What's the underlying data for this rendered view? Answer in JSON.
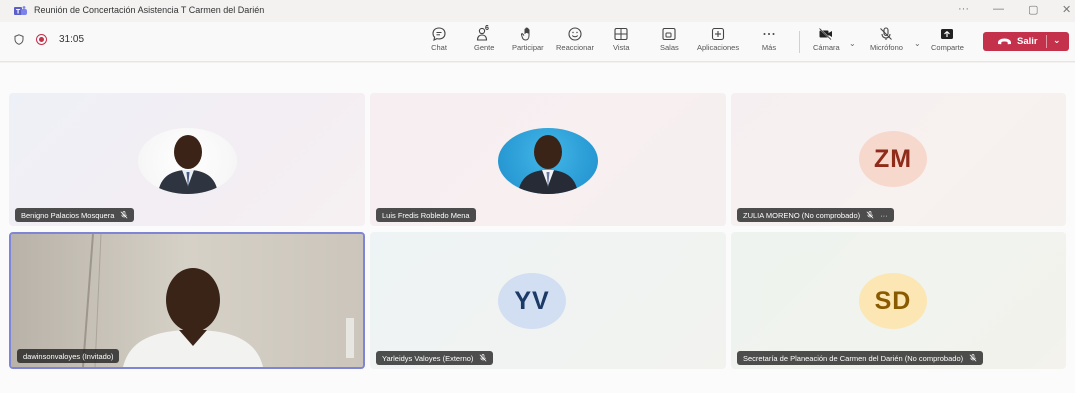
{
  "window": {
    "title": "Reunión de Concertación Asistencia T Carmen del Darién",
    "controls": {
      "more": "···",
      "minimize": "—",
      "restore": "▢",
      "close": "✕"
    }
  },
  "toolbar": {
    "timer": "31:05",
    "buttons": [
      {
        "id": "chat",
        "label": "Chat",
        "icon": "chat-icon"
      },
      {
        "id": "people",
        "label": "Gente",
        "icon": "people-icon",
        "count": "6"
      },
      {
        "id": "raise",
        "label": "Participar",
        "icon": "raise-hand-icon"
      },
      {
        "id": "react",
        "label": "Reaccionar",
        "icon": "smile-icon"
      },
      {
        "id": "view",
        "label": "Vista",
        "icon": "grid-icon"
      },
      {
        "id": "rooms",
        "label": "Salas",
        "icon": "breakout-rooms-icon"
      },
      {
        "id": "apps",
        "label": "Aplicaciones",
        "icon": "apps-icon"
      },
      {
        "id": "more",
        "label": "Más",
        "icon": "more-icon"
      },
      {
        "id": "camera",
        "label": "Cámara",
        "icon": "camera-off-icon"
      },
      {
        "id": "mic",
        "label": "Micrófono",
        "icon": "mic-off-icon"
      },
      {
        "id": "share",
        "label": "Comparte",
        "icon": "share-icon"
      }
    ],
    "leave_label": "Salir",
    "leave_color": "#c4314b"
  },
  "participants": [
    {
      "name": "Benigno Palacios Mosquera",
      "muted": true,
      "type": "photo"
    },
    {
      "name": "Luis Fredis Robledo Mena",
      "muted": false,
      "type": "photo"
    },
    {
      "name": "ZULIA MORENO (No comprobado)",
      "muted": true,
      "more": "···",
      "type": "initials",
      "initials": "ZM",
      "bg": "#f7d8cd",
      "fg": "#8f2b1a"
    },
    {
      "name": "dawinsonvaloyes (Invitado)",
      "muted": false,
      "type": "video",
      "active_speaker": true
    },
    {
      "name": "Yarleidys Valoyes (Externo)",
      "muted": true,
      "type": "initials",
      "initials": "YV",
      "bg": "#d2dff2",
      "fg": "#1b3a66"
    },
    {
      "name": "Secretaría de Planeación de Carmen del Darién (No comprobado)",
      "muted": true,
      "type": "initials",
      "initials": "SD",
      "bg": "#fbe6b4",
      "fg": "#8a5a00"
    }
  ],
  "colors": {
    "accent": "#6264a7",
    "recording": "#c4314b"
  }
}
